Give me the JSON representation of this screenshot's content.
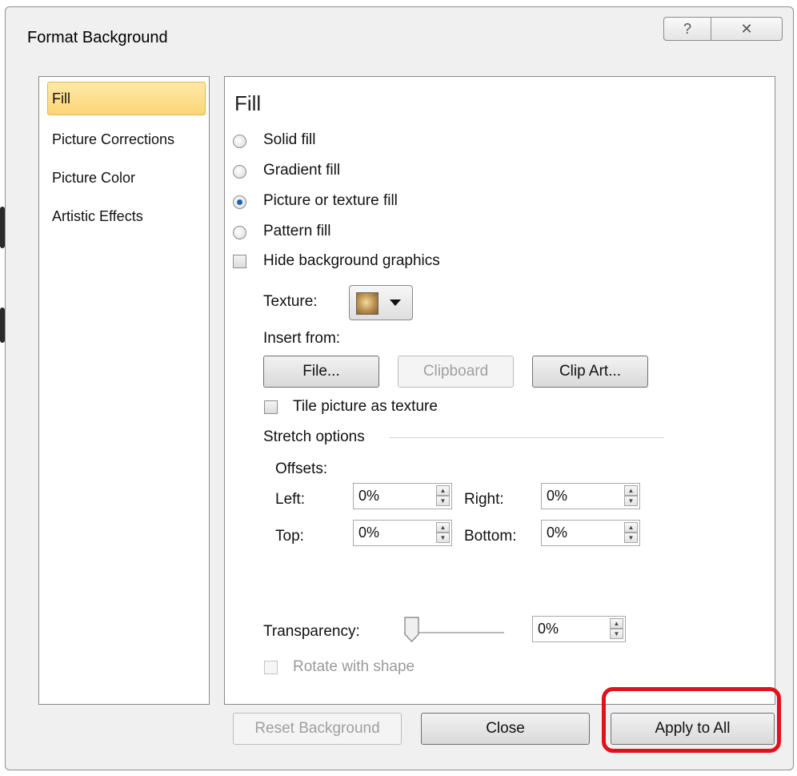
{
  "dialog": {
    "title": "Format Background",
    "help_button": "?",
    "close_button": "✕"
  },
  "nav": {
    "items": [
      {
        "label": "Fill",
        "selected": true
      },
      {
        "label": "Picture Corrections",
        "selected": false
      },
      {
        "label": "Picture Color",
        "selected": false
      },
      {
        "label": "Artistic Effects",
        "selected": false
      }
    ]
  },
  "fill": {
    "heading": "Fill",
    "options": [
      {
        "label": "Solid fill",
        "selected": false
      },
      {
        "label": "Gradient fill",
        "selected": false
      },
      {
        "label": "Picture or texture fill",
        "selected": true
      },
      {
        "label": "Pattern fill",
        "selected": false
      }
    ],
    "hide_bg_graphics": {
      "label": "Hide background graphics",
      "checked": false
    },
    "texture_label": "Texture:",
    "insert_from_label": "Insert from:",
    "buttons": {
      "file": "File...",
      "clipboard": "Clipboard",
      "clip_art": "Clip Art..."
    },
    "tile_picture": {
      "label": "Tile picture as texture",
      "checked": false
    },
    "stretch_options": "Stretch options",
    "offsets_label": "Offsets:",
    "offsets": {
      "left_label": "Left:",
      "left_value": "0%",
      "right_label": "Right:",
      "right_value": "0%",
      "top_label": "Top:",
      "top_value": "0%",
      "bottom_label": "Bottom:",
      "bottom_value": "0%"
    },
    "transparency_label": "Transparency:",
    "transparency_value": "0%",
    "transparency_level": 0,
    "rotate_with_shape": {
      "label": "Rotate with shape",
      "checked": false,
      "enabled": false
    }
  },
  "footer": {
    "reset": "Reset Background",
    "close": "Close",
    "apply_all": "Apply to All"
  },
  "colors": {
    "selection": "#fbd574",
    "radio_dot": "#1d64b0",
    "highlight": "#e0121b"
  }
}
